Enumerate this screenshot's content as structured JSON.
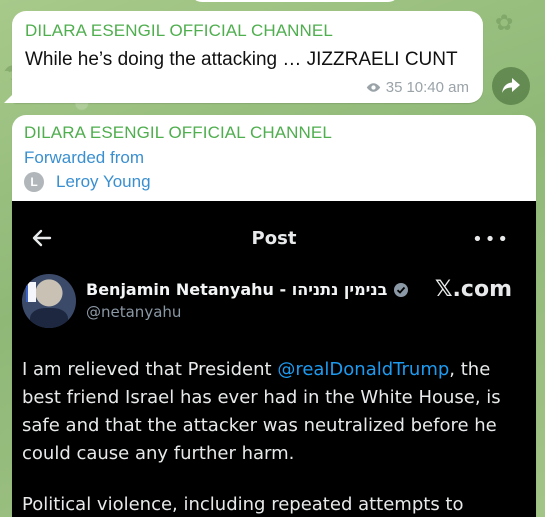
{
  "message1": {
    "sender": "DILARA ESENGIL OFFICIAL CHANNEL",
    "text": "While he’s doing the attacking … JIZZRAELI CUNT",
    "views": "35",
    "time": "10:40 am"
  },
  "message2": {
    "sender": "DILARA ESENGIL OFFICIAL CHANNEL",
    "forwarded_label": "Forwarded from",
    "forwarded_avatar_letter": "L",
    "forwarded_name": "Leroy Young"
  },
  "embedded_post": {
    "header_title": "Post",
    "author_name": "Benjamin Netanyahu - בנימין נתניהו",
    "author_handle": "@netanyahu",
    "source": "𝕏.com",
    "text_before_mention": "I am relieved that President ",
    "mention": "@realDonaldTrump",
    "text_after_mention": ", the best friend Israel has ever had in the White House, is safe and that the attacker was neutralized before he could cause any further harm.",
    "text_second_paragraph": "Political violence, including repeated attempts to"
  },
  "icons": {
    "views": "eye-icon",
    "share": "share-arrow-icon",
    "back": "arrow-left-icon",
    "more": "more-horizontal-icon",
    "verified": "verified-badge-icon"
  },
  "colors": {
    "sender": "#4fae4e",
    "link": "#3a8fd0",
    "mention": "#1d9bf0"
  }
}
